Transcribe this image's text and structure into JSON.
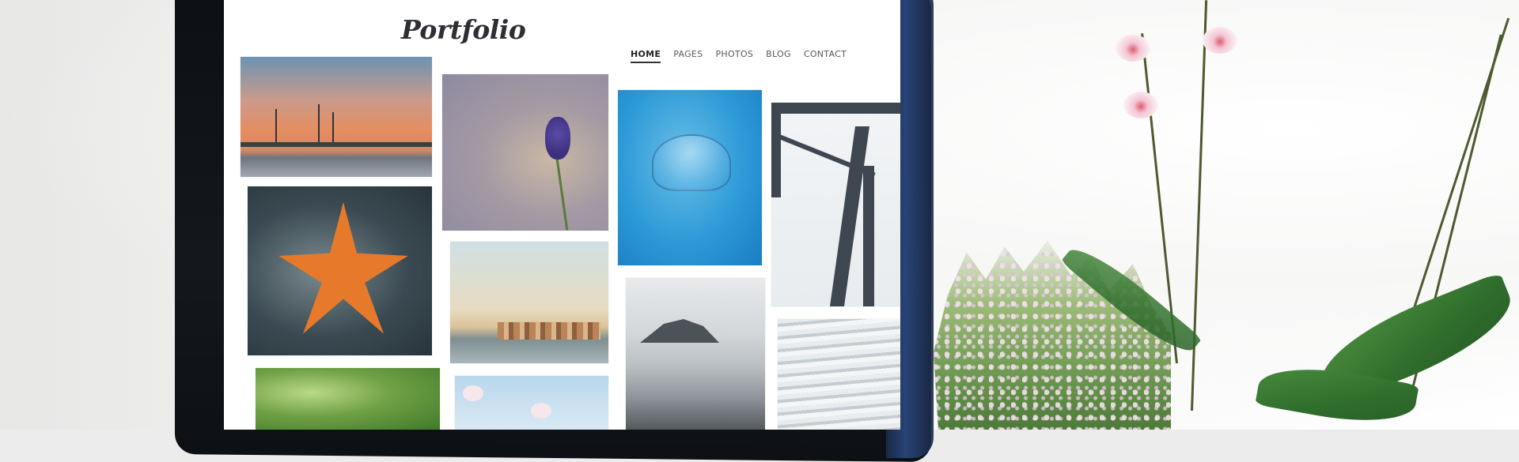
{
  "site": {
    "logo": "Portfolio",
    "nav": [
      "HOME",
      "PAGES",
      "PHOTOS",
      "BLOG",
      "CONTACT"
    ],
    "active_nav_index": 0
  },
  "colors": {
    "accent_nav_active": "#222222",
    "nav_text": "#55595f",
    "screen_bg": "#ffffff",
    "monitor_bezel": "#0c0f13"
  }
}
